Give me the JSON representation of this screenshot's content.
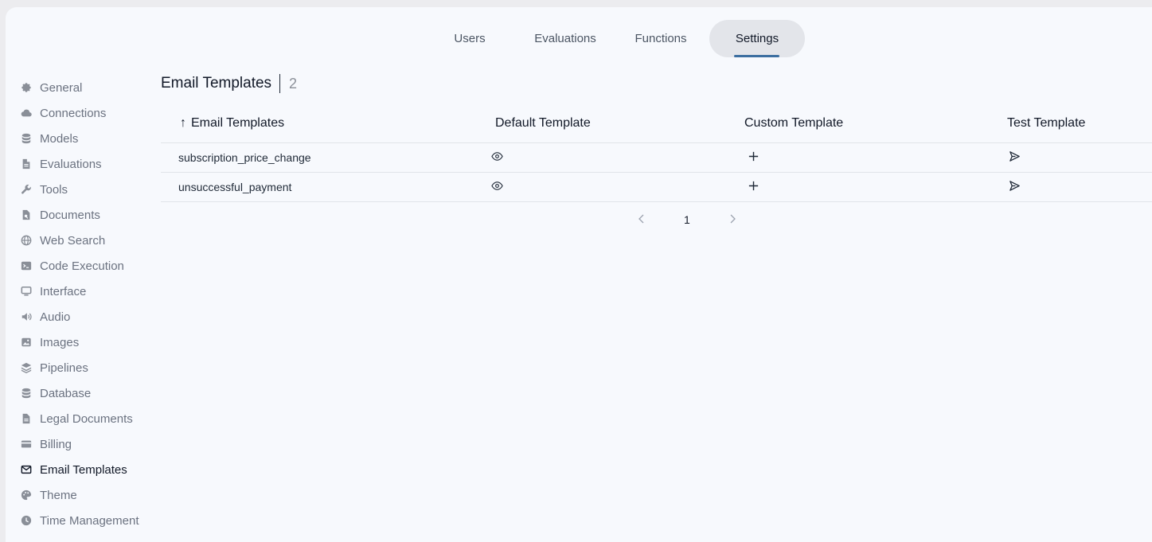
{
  "tabs": [
    {
      "label": "Users"
    },
    {
      "label": "Evaluations"
    },
    {
      "label": "Functions"
    },
    {
      "label": "Settings"
    }
  ],
  "sidebar": {
    "items": [
      {
        "label": "General",
        "icon": "gear-icon"
      },
      {
        "label": "Connections",
        "icon": "cloud-icon"
      },
      {
        "label": "Models",
        "icon": "database-icon"
      },
      {
        "label": "Evaluations",
        "icon": "document-icon"
      },
      {
        "label": "Tools",
        "icon": "wrench-icon"
      },
      {
        "label": "Documents",
        "icon": "document-search-icon"
      },
      {
        "label": "Web Search",
        "icon": "globe-icon"
      },
      {
        "label": "Code Execution",
        "icon": "terminal-icon"
      },
      {
        "label": "Interface",
        "icon": "monitor-icon"
      },
      {
        "label": "Audio",
        "icon": "speaker-icon"
      },
      {
        "label": "Images",
        "icon": "image-icon"
      },
      {
        "label": "Pipelines",
        "icon": "layers-icon"
      },
      {
        "label": "Database",
        "icon": "database-icon"
      },
      {
        "label": "Legal Documents",
        "icon": "document-icon"
      },
      {
        "label": "Billing",
        "icon": "credit-card-icon"
      },
      {
        "label": "Email Templates",
        "icon": "envelope-icon"
      },
      {
        "label": "Theme",
        "icon": "palette-icon"
      },
      {
        "label": "Time Management",
        "icon": "clock-icon"
      }
    ]
  },
  "main": {
    "title": "Email Templates",
    "count": "2",
    "columns": [
      "Email Templates",
      "Default Template",
      "Custom Template",
      "Test Template"
    ],
    "rows": [
      {
        "name": "subscription_price_change"
      },
      {
        "name": "unsuccessful_payment"
      }
    ],
    "page": "1"
  }
}
